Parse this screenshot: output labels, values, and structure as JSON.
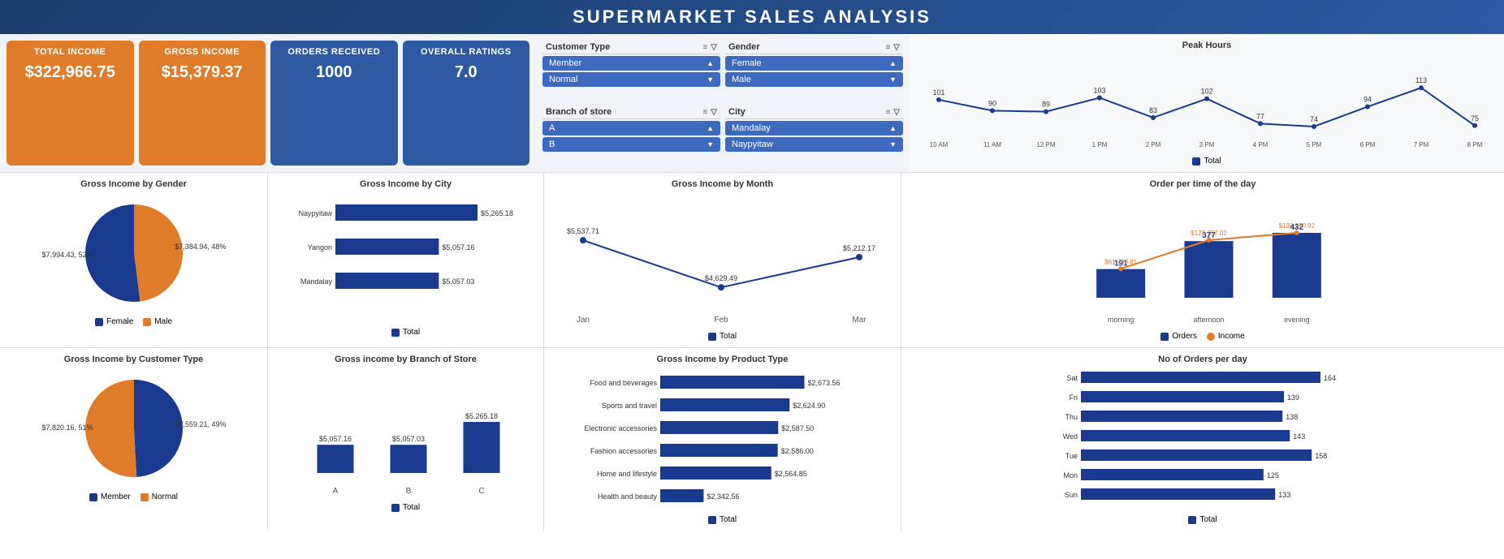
{
  "title": "SUPERMARKET SALES ANALYSIS",
  "kpis": [
    {
      "label": "TOTAL INCOME",
      "value": "$322,966.75",
      "type": "orange"
    },
    {
      "label": "GROSS INCOME",
      "value": "$15,379.37",
      "type": "orange"
    },
    {
      "label": "ORDERS RECEIVED",
      "value": "1000",
      "type": "blue"
    },
    {
      "label": "OVERALL RATINGS",
      "value": "7.0",
      "type": "blue"
    }
  ],
  "filters": {
    "customer_type": {
      "label": "Customer Type",
      "items": [
        "Member",
        "Normal"
      ]
    },
    "gender": {
      "label": "Gender",
      "items": [
        "Female",
        "Male"
      ]
    },
    "branch_store": {
      "label": "Branch of store",
      "items": [
        "A",
        "B"
      ]
    },
    "city": {
      "label": "City",
      "items": [
        "Mandalay",
        "Naypyitaw"
      ]
    }
  },
  "peak_hours": {
    "title": "Peak Hours",
    "data": [
      {
        "hour": "10 AM",
        "value": 101
      },
      {
        "hour": "11 AM",
        "value": 90
      },
      {
        "hour": "12 PM",
        "value": 89
      },
      {
        "hour": "1 PM",
        "value": 103
      },
      {
        "hour": "2 PM",
        "value": 83
      },
      {
        "hour": "3 PM",
        "value": 102
      },
      {
        "hour": "4 PM",
        "value": 77
      },
      {
        "hour": "5 PM",
        "value": 74
      },
      {
        "hour": "6 PM",
        "value": 94
      },
      {
        "hour": "7 PM",
        "value": 113
      },
      {
        "hour": "8 PM",
        "value": 75
      }
    ],
    "legend": "Total"
  },
  "gross_income_gender": {
    "title": "Gross Income by Gender",
    "female": {
      "value": "$7,384.94",
      "pct": "48%"
    },
    "male": {
      "value": "$7,994.43",
      "pct": "52%"
    },
    "legend": [
      "Female",
      "Male"
    ]
  },
  "gross_income_city": {
    "title": "Gross Income by City",
    "data": [
      {
        "city": "Naypyitaw",
        "value": 5265.18,
        "label": "$5,265.18"
      },
      {
        "city": "Yangon",
        "value": 5057.16,
        "label": "$5,057.16"
      },
      {
        "city": "Mandalay",
        "value": 5057.03,
        "label": "$5,057.03"
      }
    ],
    "legend": "Total"
  },
  "gross_income_month": {
    "title": "Gross Income by Month",
    "data": [
      {
        "month": "Jan",
        "value": 5537.71,
        "label": "$5,537.71"
      },
      {
        "month": "Feb",
        "value": 4629.49,
        "label": "$4,629.49"
      },
      {
        "month": "Mar",
        "value": 5212.17,
        "label": "$5,212.17"
      }
    ],
    "legend": "Total"
  },
  "order_per_time": {
    "title": "Order per time of the day",
    "data": [
      {
        "period": "morning",
        "orders": 191,
        "income": 61798.81,
        "income_label": "$61,798.81"
      },
      {
        "period": "afternoon",
        "orders": 377,
        "income": 122797.02,
        "income_label": "$122,797.02"
      },
      {
        "period": "evening",
        "orders": 432,
        "income": 138370.92,
        "income_label": "$138,370.92"
      }
    ],
    "legend": [
      "Orders",
      "Income"
    ]
  },
  "gross_income_customer": {
    "title": "Gross Income by Customer Type",
    "member": {
      "value": "$7,559.21",
      "pct": "49%"
    },
    "normal": {
      "value": "$7,820.16",
      "pct": "51%"
    },
    "legend": [
      "Member",
      "Normal"
    ]
  },
  "gross_income_branch": {
    "title": "Gross income by Branch of Store",
    "data": [
      {
        "branch": "A",
        "value": 5057.16,
        "label": "$5,057.16"
      },
      {
        "branch": "B",
        "value": 5057.03,
        "label": "$5,057.03"
      },
      {
        "branch": "C",
        "value": 5265.18,
        "label": "$5,265.18"
      }
    ],
    "legend": "Total"
  },
  "gross_income_product": {
    "title": "Gross Income by Product Type",
    "data": [
      {
        "product": "Food and beverages",
        "value": 2673.56,
        "label": "$2,673.56"
      },
      {
        "product": "Sports and travel",
        "value": 2624.9,
        "label": "$2,624.90"
      },
      {
        "product": "Electronic accessories",
        "value": 2587.5,
        "label": "$2,587.50"
      },
      {
        "product": "Fashion accessories",
        "value": 2586.0,
        "label": "$2,586.00"
      },
      {
        "product": "Home and lifestyle",
        "value": 2564.85,
        "label": "$2,564.85"
      },
      {
        "product": "Health and beauty",
        "value": 2342.56,
        "label": "$2,342.56"
      }
    ],
    "legend": "Total"
  },
  "orders_per_day": {
    "title": "No of Orders per day",
    "data": [
      {
        "day": "Sat",
        "value": 164
      },
      {
        "day": "Fri",
        "value": 139
      },
      {
        "day": "Thu",
        "value": 138
      },
      {
        "day": "Wed",
        "value": 143
      },
      {
        "day": "Tue",
        "value": 158
      },
      {
        "day": "Mon",
        "value": 125
      },
      {
        "day": "Sun",
        "value": 133
      }
    ],
    "legend": "Total"
  }
}
